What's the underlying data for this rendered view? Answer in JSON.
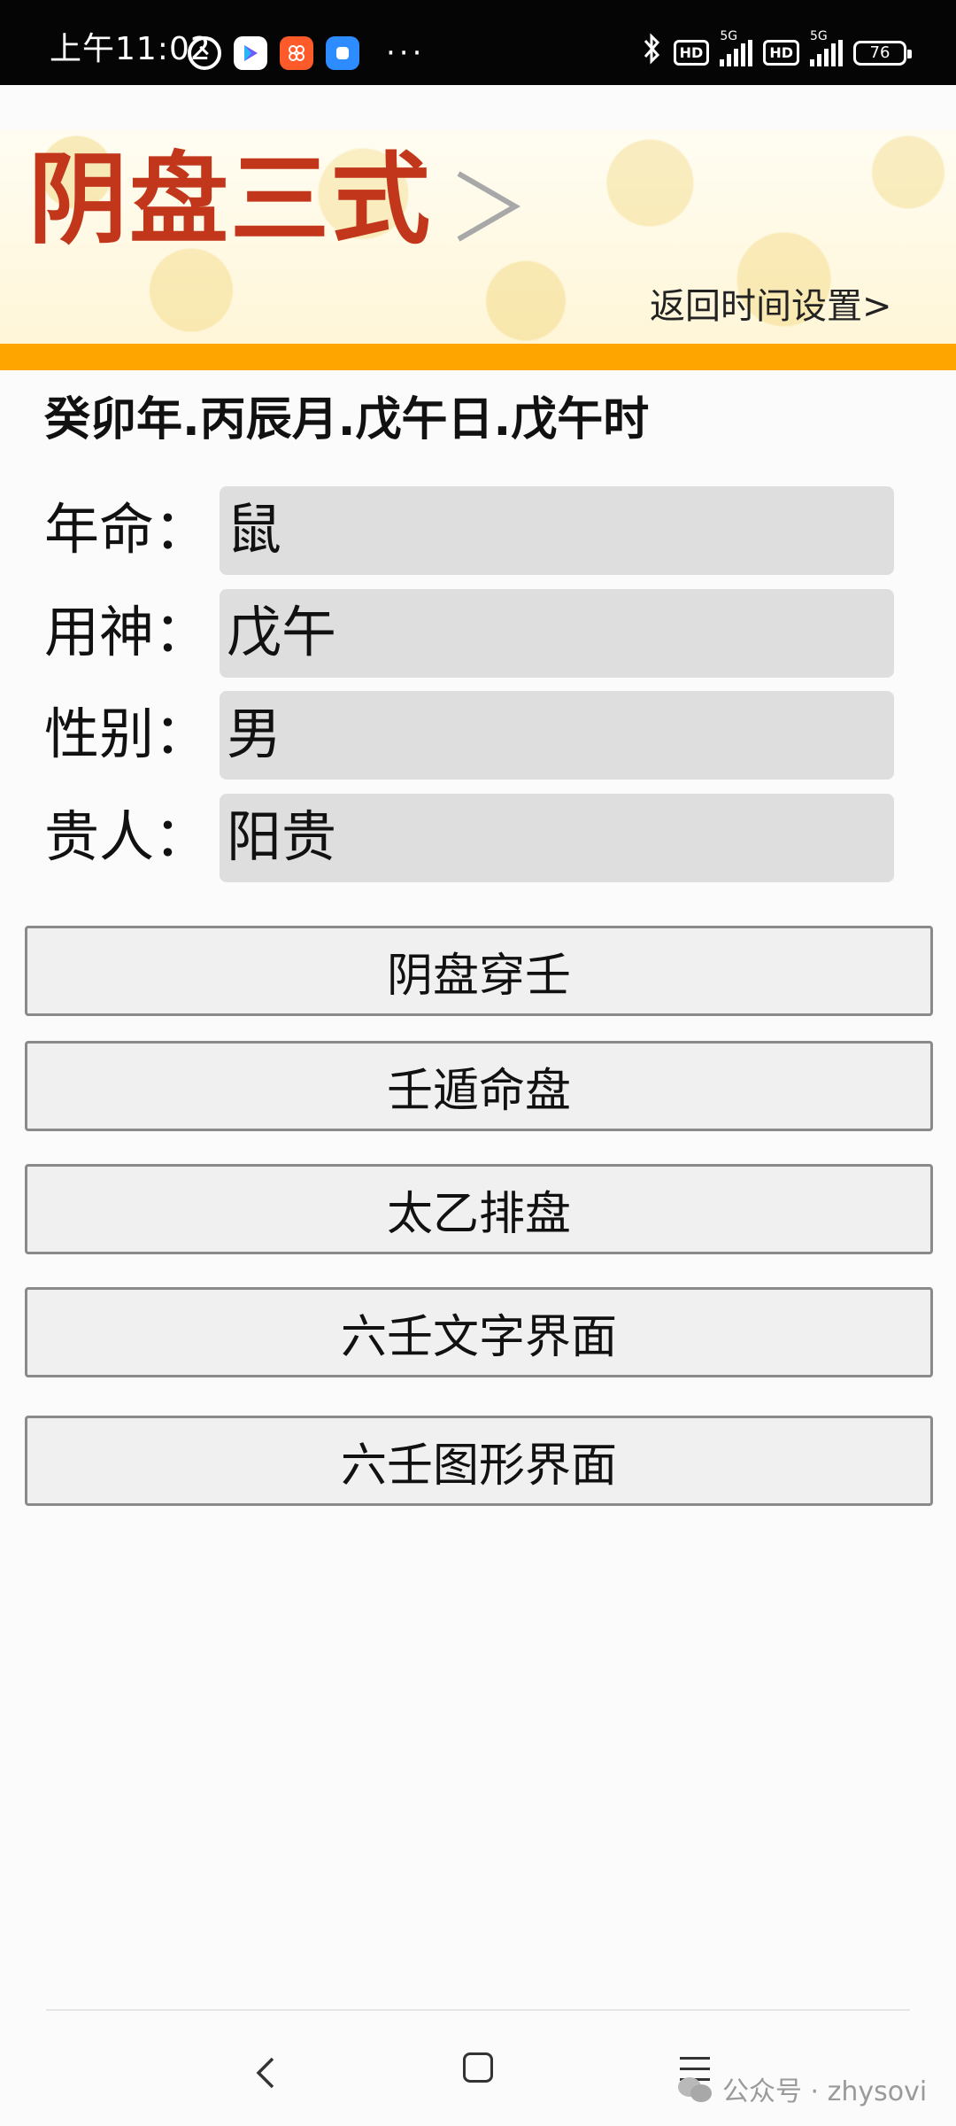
{
  "status_bar": {
    "time": "上午11:02",
    "battery": "76",
    "hd1": "HD",
    "hd2": "HD",
    "net1": "5G",
    "net2": "5G",
    "more": "···"
  },
  "header": {
    "title": "阴盘三式",
    "back_link": "返回时间设置>"
  },
  "main": {
    "ganzhi": "癸卯年.丙辰月.戊午日.戊午时",
    "fields": [
      {
        "label": "年命：",
        "value": "鼠"
      },
      {
        "label": "用神：",
        "value": "戊午"
      },
      {
        "label": "性别：",
        "value": "男"
      },
      {
        "label": "贵人：",
        "value": "阳贵"
      }
    ],
    "buttons": [
      "阴盘穿壬",
      "壬遁命盘",
      "太乙排盘",
      "六壬文字界面",
      "六壬图形界面"
    ]
  },
  "watermark": {
    "text": "公众号 · zhysovi"
  },
  "colors": {
    "title": "#c2371c",
    "strip": "#ffa500",
    "field_bg": "#dedede",
    "button_bg": "#f0f0f0"
  }
}
